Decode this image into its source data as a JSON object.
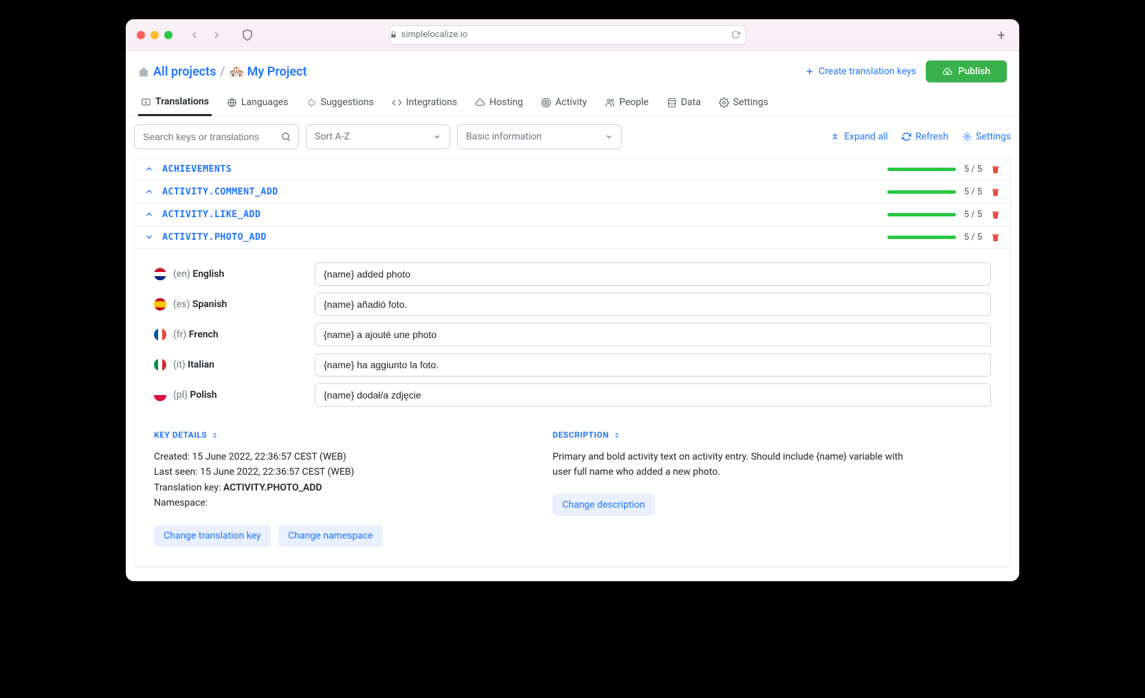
{
  "browser": {
    "url": "simplelocalize.io"
  },
  "breadcrumb": {
    "all_projects": "All projects",
    "project_name": "My Project",
    "project_emoji": "🏘️"
  },
  "header_actions": {
    "create_keys": "Create translation keys",
    "publish": "Publish"
  },
  "tabs": {
    "translations": "Translations",
    "languages": "Languages",
    "suggestions": "Suggestions",
    "integrations": "Integrations",
    "hosting": "Hosting",
    "activity": "Activity",
    "people": "People",
    "data": "Data",
    "settings": "Settings"
  },
  "filters": {
    "search_placeholder": "Search keys or translations",
    "sort": "Sort A-Z",
    "info": "Basic information",
    "expand_all": "Expand all",
    "refresh": "Refresh",
    "settings": "Settings"
  },
  "keys": [
    {
      "name": "ACHIEVEMENTS",
      "count": "5 / 5",
      "expanded": false
    },
    {
      "name": "ACTIVITY.COMMENT_ADD",
      "count": "5 / 5",
      "expanded": false
    },
    {
      "name": "ACTIVITY.LIKE_ADD",
      "count": "5 / 5",
      "expanded": false
    },
    {
      "name": "ACTIVITY.PHOTO_ADD",
      "count": "5 / 5",
      "expanded": true
    }
  ],
  "translations": [
    {
      "flag": "en",
      "code": "(en)",
      "name": "English",
      "value": "{name} added photo"
    },
    {
      "flag": "es",
      "code": "(es)",
      "name": "Spanish",
      "value": "{name} añadió foto."
    },
    {
      "flag": "fr",
      "code": "(fr)",
      "name": "French",
      "value": "{name} a ajouté une photo"
    },
    {
      "flag": "it",
      "code": "(it)",
      "name": "Italian",
      "value": "{name} ha aggiunto la foto."
    },
    {
      "flag": "pl",
      "code": "(pl)",
      "name": "Polish",
      "value": "{name} dodał/a zdjęcie"
    }
  ],
  "key_details": {
    "title": "KEY DETAILS",
    "created_label": "Created: ",
    "created": "15 June 2022, 22:36:57 CEST (WEB)",
    "lastseen_label": "Last seen: ",
    "lastseen": "15 June 2022, 22:36:57 CEST (WEB)",
    "tkey_label": "Translation key: ",
    "tkey": "ACTIVITY.PHOTO_ADD",
    "ns_label": "Namespace:",
    "change_key": "Change translation key",
    "change_ns": "Change namespace"
  },
  "description": {
    "title": "DESCRIPTION",
    "text": "Primary and bold activity text on activity entry. Should include {name} variable with user full name who added a new photo.",
    "change": "Change description"
  }
}
